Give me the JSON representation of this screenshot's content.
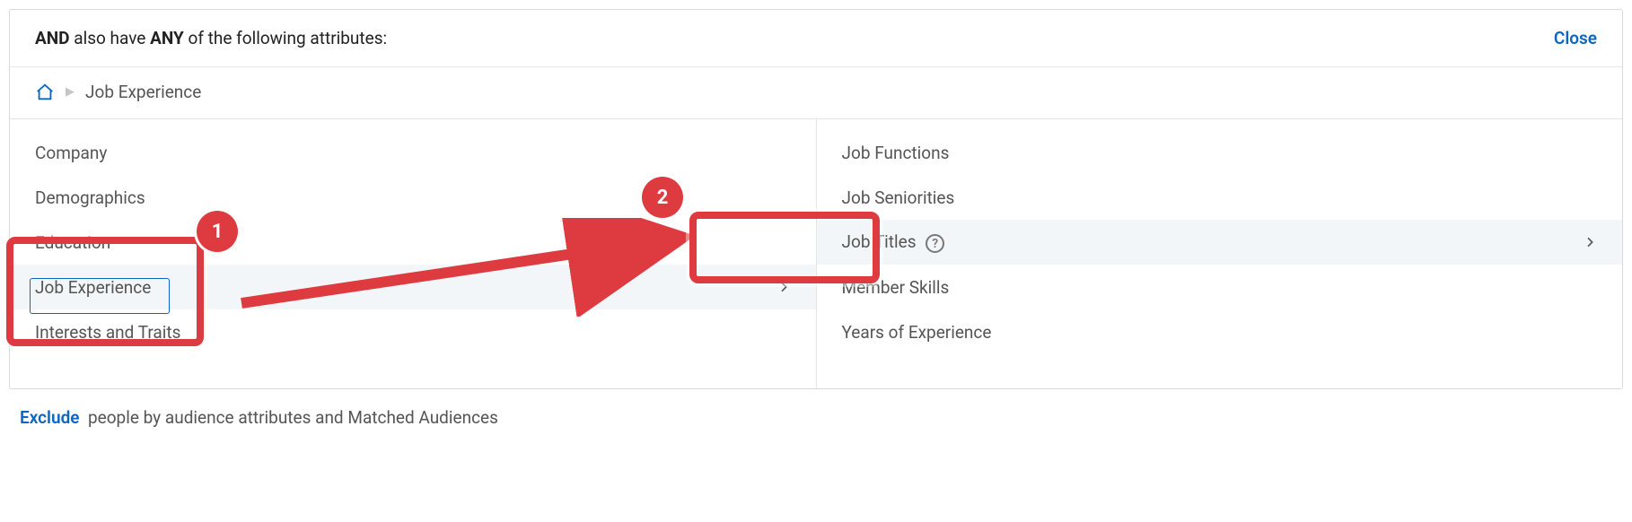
{
  "header": {
    "and": "AND",
    "also_have": "also have",
    "any": "ANY",
    "rest": "of the following attributes:",
    "close": "Close"
  },
  "breadcrumb": {
    "current": "Job Experience"
  },
  "left_column": {
    "items": [
      "Company",
      "Demographics",
      "Education",
      "Job Experience",
      "Interests and Traits"
    ]
  },
  "right_column": {
    "items": [
      "Job Functions",
      "Job Seniorities",
      "Job Titles",
      "Member Skills",
      "Years of Experience"
    ]
  },
  "below": {
    "exclude": "Exclude",
    "rest": "people by audience attributes and Matched Audiences"
  },
  "annotation": {
    "badge1": "1",
    "badge2": "2"
  }
}
